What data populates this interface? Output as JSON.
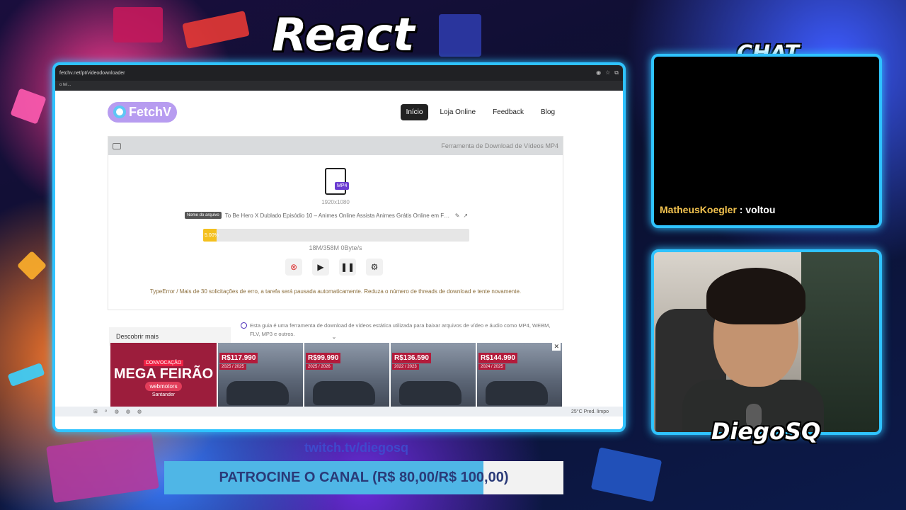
{
  "overlay": {
    "title": "React",
    "chat_title": "CHAT",
    "streamer_name": "DiegoSQ",
    "social": "twitch.tv/diegosq",
    "sponsor": {
      "label": "PATROCINE O CANAL (R$ 80,00/R$ 100,00)",
      "progress": 0.8
    }
  },
  "chat": {
    "messages": [
      {
        "user": "MatheusKoegler",
        "separator": " : ",
        "text": "voltou"
      }
    ]
  },
  "browser": {
    "url": "fetchv.net/pt/videodownloader",
    "bookmark": "o tel...",
    "icons": [
      "eye-icon",
      "star-icon",
      "extensions-icon"
    ]
  },
  "site": {
    "logo": "FetchV",
    "nav": [
      {
        "label": "Início",
        "active": true
      },
      {
        "label": "Loja Online",
        "active": false
      },
      {
        "label": "Feedback",
        "active": false
      },
      {
        "label": "Blog",
        "active": false
      }
    ],
    "tool": {
      "header": "Ferramenta de Download de Vídeos MP4",
      "file_badge": "MP4",
      "resolution": "1920x1080",
      "filename_label": "Nome do arquivo",
      "filename": "To Be Hero X Dublado Episódio 10 – Animes Online Assista Animes Grátis Online em FULL...",
      "progress_text": "5.00%",
      "progress": 0.05,
      "sizes": "18M/358M    0Byte/s",
      "error": "TypeError / Mais de 30 solicitações de erro, a tarefa será pausada automaticamente. Reduza o número de threads de download e tente novamente."
    },
    "discover": "Descobrir mais",
    "guide": "Esta guia é uma ferramenta de download de vídeos estática utilizada para baixar arquivos de vídeo e áudio como MP4, WEBM, FLV, MP3 e outros."
  },
  "ad": {
    "promo_small": "CONVOCAÇÃO",
    "promo_big": "MEGA FEIRÃO",
    "promo_brand": "webmotors",
    "promo_sponsor": "Santander",
    "cars": [
      {
        "price": "R$117.990",
        "year": "2025 / 2025"
      },
      {
        "price": "R$99.990",
        "year": "2025 / 2026"
      },
      {
        "price": "R$136.590",
        "year": "2022 / 2023"
      },
      {
        "price": "R$144.990",
        "year": "2024 / 2025"
      }
    ]
  },
  "taskbar": {
    "status": "25°C  Pred. limpo"
  }
}
